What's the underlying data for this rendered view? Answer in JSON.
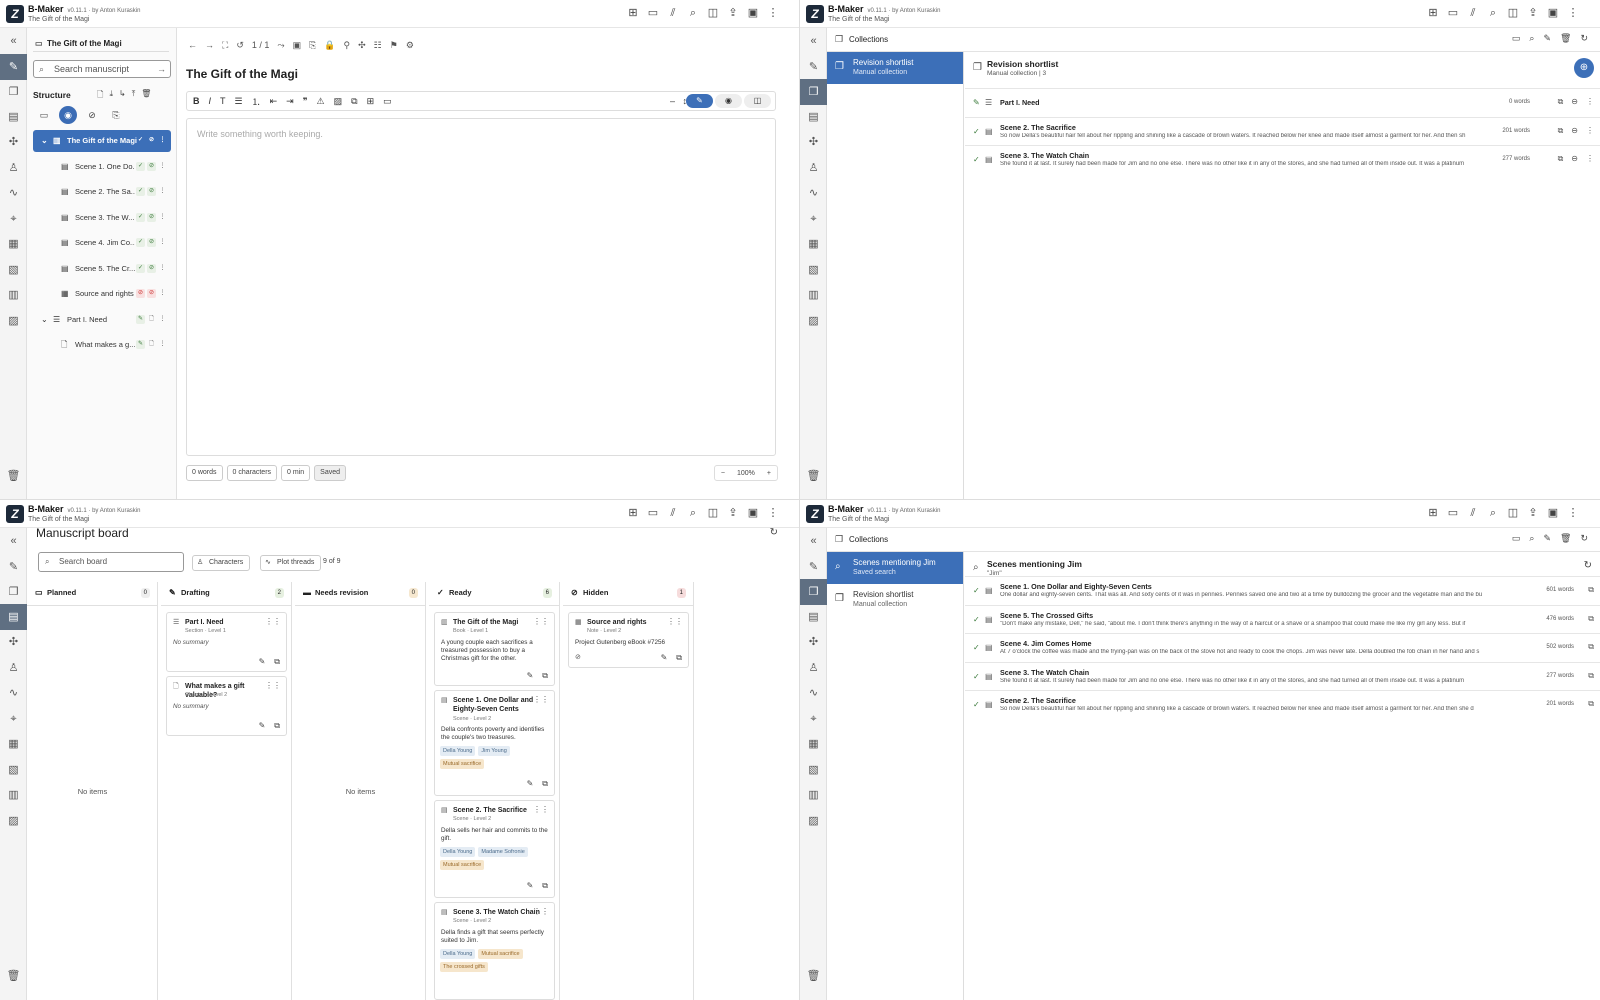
{
  "app": {
    "name": "B-Maker",
    "version": "v0.11.1 · by Anton Kuraskin",
    "project": "The Gift of the Magi"
  },
  "topicons": [
    "add-doc-icon",
    "folder-icon",
    "hatch-icon",
    "search-icon",
    "split-icon",
    "export-icon",
    "calendar-icon",
    "more-icon"
  ],
  "q1": {
    "selector": "The Gift of the Magi",
    "search_placeholder": "Search manuscript",
    "structure_label": "Structure",
    "tree": [
      {
        "label": "The Gift of the Magi",
        "selected": true
      },
      {
        "label": "Scene 1. One Do..."
      },
      {
        "label": "Scene 2. The Sa..."
      },
      {
        "label": "Scene 3. The W..."
      },
      {
        "label": "Scene 4. Jim Co..."
      },
      {
        "label": "Scene 5. The Cr..."
      },
      {
        "label": "Source and rights"
      },
      {
        "label": "Part I. Need"
      },
      {
        "label": "What makes a g..."
      }
    ],
    "page_counter": "1 / 1",
    "doc_title": "The Gift of the Magi",
    "placeholder": "Write something worth keeping.",
    "status": {
      "words": "0 words",
      "chars": "0 characters",
      "time": "0 min",
      "saved": "Saved"
    },
    "zoom": "100%"
  },
  "q2": {
    "collections_label": "Collections",
    "list": [
      {
        "title": "Revision shortlist",
        "sub": "Manual collection"
      }
    ],
    "main_title": "Revision shortlist",
    "main_sub": "Manual collection | 3",
    "rows": [
      {
        "title": "Part I. Need",
        "text": "",
        "words": "0 words"
      },
      {
        "title": "Scene 2. The Sacrifice",
        "text": "So now Della's beautiful hair fell about her rippling and shining like a cascade of brown waters. It reached below her knee and made itself almost a garment for her. And then sh",
        "words": "201 words"
      },
      {
        "title": "Scene 3. The Watch Chain",
        "text": "She found it at last. It surely had been made for Jim and no one else. There was no other like it in any of the stores, and she had turned all of them inside out. It was a platinum",
        "words": "277 words"
      }
    ]
  },
  "q3": {
    "title": "Manuscript board",
    "search_placeholder": "Search board",
    "chip_characters": "Characters",
    "chip_threads": "Plot threads",
    "count": "9 of 9",
    "no_items": "No items",
    "columns": [
      {
        "name": "Planned",
        "n": "0"
      },
      {
        "name": "Drafting",
        "n": "2"
      },
      {
        "name": "Needs revision",
        "n": "0"
      },
      {
        "name": "Ready",
        "n": "6"
      },
      {
        "name": "Hidden",
        "n": "1"
      }
    ],
    "drafting": [
      {
        "title": "Part I. Need",
        "sub": "Section · Level 1",
        "desc": "No summary"
      },
      {
        "title": "What makes a gift valuable?",
        "sub": "Chapter · Level 2",
        "desc": "No summary"
      }
    ],
    "ready": [
      {
        "title": "The Gift of the Magi",
        "sub": "Book · Level 1",
        "desc": "A young couple each sacrifices a treasured possession to buy a Christmas gift for the other.",
        "tags": []
      },
      {
        "title": "Scene 1. One Dollar and Eighty-Seven Cents",
        "sub": "Scene · Level 2",
        "desc": "Della confronts poverty and identifies the couple's two treasures.",
        "tags": [
          "Della Young",
          "Jim Young"
        ],
        "threads": [
          "Mutual sacrifice"
        ]
      },
      {
        "title": "Scene 2. The Sacrifice",
        "sub": "Scene · Level 2",
        "desc": "Della sells her hair and commits to the gift.",
        "tags": [
          "Della Young",
          "Madame Sofronie"
        ],
        "threads": [
          "Mutual sacrifice"
        ]
      },
      {
        "title": "Scene 3. The Watch Chain",
        "sub": "Scene · Level 2",
        "desc": "Della finds a gift that seems perfectly suited to Jim.",
        "tags": [
          "Della Young"
        ],
        "threads": [
          "Mutual sacrifice",
          "The crossed gifts"
        ]
      }
    ],
    "hidden": [
      {
        "title": "Source and rights",
        "sub": "Note · Level 2",
        "desc": "Project Gutenberg eBook #7256"
      }
    ]
  },
  "q4": {
    "collections_label": "Collections",
    "list": [
      {
        "title": "Scenes mentioning Jim",
        "sub": "Saved search"
      },
      {
        "title": "Revision shortlist",
        "sub": "Manual collection"
      }
    ],
    "main_title": "Scenes mentioning Jim",
    "main_sub": "\"Jim\"",
    "rows": [
      {
        "title": "Scene 1. One Dollar and Eighty-Seven Cents",
        "text": "One dollar and eighty-seven cents. That was all. And sixty cents of it was in pennies. Pennies saved one and two at a time by bulldozing the grocer and the vegetable man and the bu",
        "words": "601 words"
      },
      {
        "title": "Scene 5. The Crossed Gifts",
        "text": "\"Don't make any mistake, Dell,\" he said, \"about me. I don't think there's anything in the way of a haircut or a shave or a shampoo that could make me like my girl any less. But if",
        "words": "476 words"
      },
      {
        "title": "Scene 4. Jim Comes Home",
        "text": "At 7 o'clock the coffee was made and the frying-pan was on the back of the stove hot and ready to cook the chops. Jim was never late. Della doubled the fob chain in her hand and s",
        "words": "502 words"
      },
      {
        "title": "Scene 3. The Watch Chain",
        "text": "She found it at last. It surely had been made for Jim and no one else. There was no other like it in any of the stores, and she had turned all of them inside out. It was a platinum",
        "words": "277 words"
      },
      {
        "title": "Scene 2. The Sacrifice",
        "text": "So now Della's beautiful hair fell about her rippling and shining like a cascade of brown waters. It reached below her knee and made itself almost a garment for her. And then she d",
        "words": "201 words"
      }
    ]
  },
  "colors": {
    "accent": "#3c6fb8",
    "rail_active": "#5f6f82"
  }
}
